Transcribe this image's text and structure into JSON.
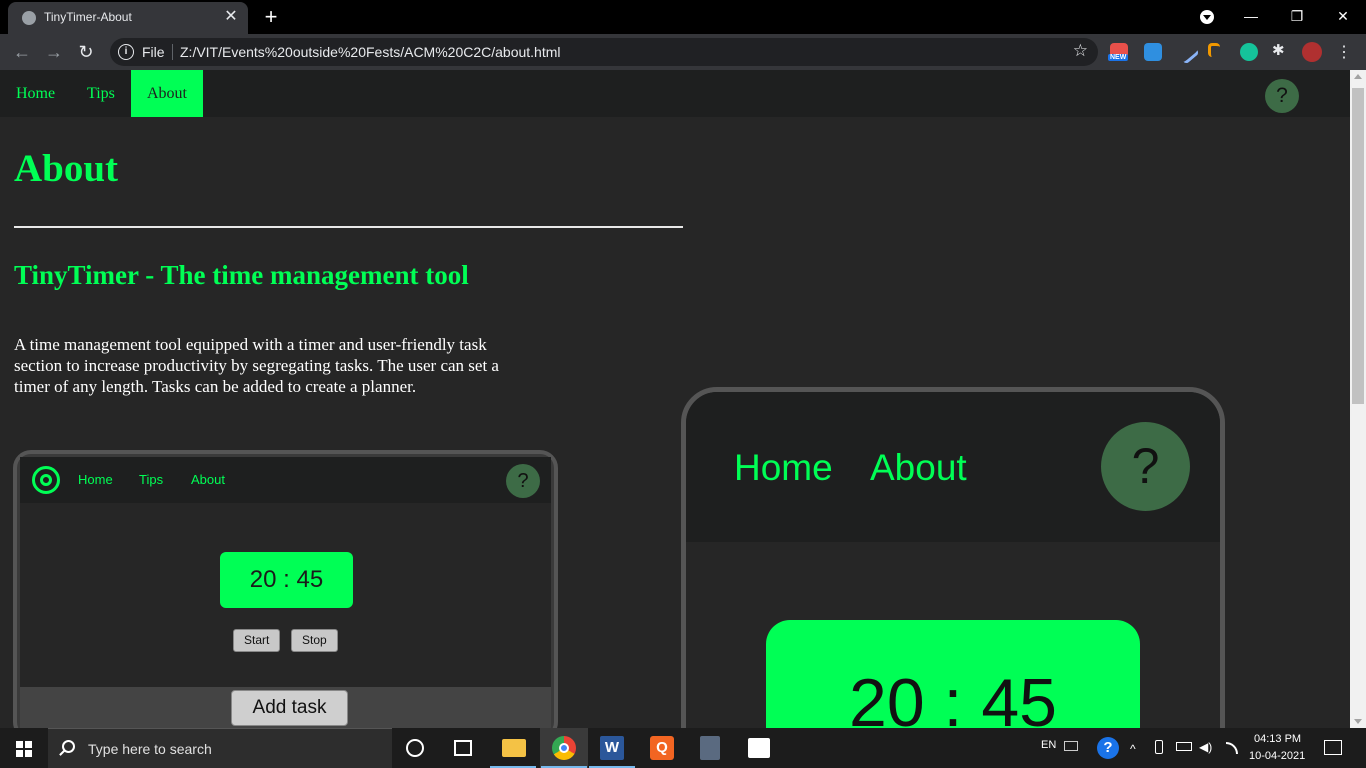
{
  "browser": {
    "tab_title": "TinyTimer-About",
    "tab_close": "✕",
    "new_tab": "+",
    "win_min": "—",
    "win_max": "❐",
    "win_close": "✕",
    "back": "←",
    "forward": "→",
    "reload": "↻",
    "info": "i",
    "file_label": "File",
    "url": "Z:/VIT/Events%20outside%20Fests/ACM%20C2C/about.html",
    "bookmark_star": "☆",
    "ext_new_badge": "NEW",
    "menu": "⋮"
  },
  "site_nav": {
    "links": [
      "Home",
      "Tips",
      "About"
    ],
    "active": "About",
    "help": "?"
  },
  "content": {
    "title": "About",
    "subtitle": "TinyTimer - The time management tool",
    "description": "A time management tool equipped with a timer and user-friendly task section to increase productivity by segregating tasks. The user can set a timer of any length. Tasks can be added to create a planner."
  },
  "laptop_preview": {
    "links": [
      "Home",
      "Tips",
      "About"
    ],
    "help": "?",
    "timer": "20 : 45",
    "start": "Start",
    "stop": "Stop",
    "add_task": "Add task"
  },
  "phone_preview": {
    "links": [
      "Home",
      "About"
    ],
    "help": "?",
    "timer": "20 : 45"
  },
  "taskbar": {
    "search_placeholder": "Type here to search",
    "lang": "EN",
    "time": "04:13 PM",
    "date": "10-04-2021"
  },
  "colors": {
    "accent": "#00ff55",
    "page_bg": "#262626",
    "nav_bg": "#1e1f1f",
    "help_bg": "#3d6b46"
  }
}
